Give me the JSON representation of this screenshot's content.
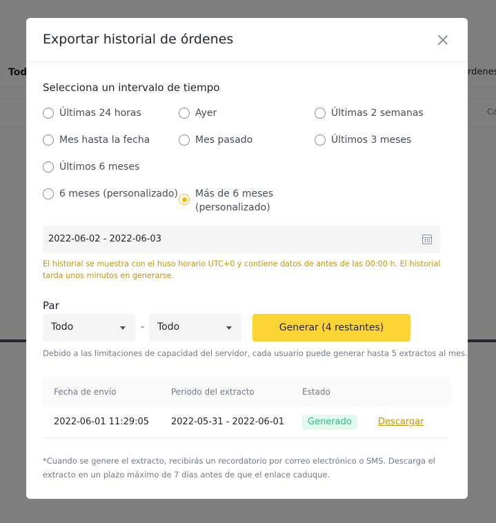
{
  "background": {
    "left_text": "Tod",
    "right_text": "rdenes d",
    "right_text2": "Ca"
  },
  "modal": {
    "title": "Exportar historial de órdenes",
    "section_title": "Selecciona un intervalo de tiempo",
    "options": [
      {
        "label": "Últimas 24 horas",
        "checked": false
      },
      {
        "label": "Ayer",
        "checked": false
      },
      {
        "label": "Últimas 2 semanas",
        "checked": false
      },
      {
        "label": "Mes hasta la fecha",
        "checked": false
      },
      {
        "label": "Mes pasado",
        "checked": false
      },
      {
        "label": "Últimos 3 meses",
        "checked": false
      },
      {
        "label": "Últimos 6 meses",
        "checked": false
      },
      {
        "label": "6 meses (personalizado)",
        "checked": false
      },
      {
        "label": "Más de 6 meses\n(personalizado)",
        "checked": true
      }
    ],
    "date_range": "2022-06-02 - 2022-06-03",
    "notice": "El historial se muestra con el huso horario UTC+0 y contiene datos de antes de las 00:00 h. El historial tarda unos minutos en generarse.",
    "pair": {
      "label": "Par",
      "base_value": "Todo",
      "separator": "-",
      "quote_value": "Todo"
    },
    "generate_button": "Generar (4 restantes)",
    "limit_note": "Debido a las limitaciones de capacidad del servidor, cada usuario puede generar hasta 5 extractos al mes.",
    "table": {
      "headers": [
        "Fecha de envío",
        "Periodo del extracto",
        "Estado"
      ],
      "rows": [
        {
          "sent": "2022-06-01 11:29:05",
          "period": "2022-05-31 - 2022-06-01",
          "status": "Generado",
          "action": "Descargar"
        }
      ]
    },
    "footnote": "*Cuando se genere el extracto, recibirás un recordatorio por correo electrónico o SMS. Descarga el extracto en un plazo máximo de 7 días antes de que el enlace caduque."
  },
  "colors": {
    "accent": "#f0b90b",
    "button": "#fcd535",
    "warning_text": "#c99400",
    "status_green": "#2ebd85"
  }
}
